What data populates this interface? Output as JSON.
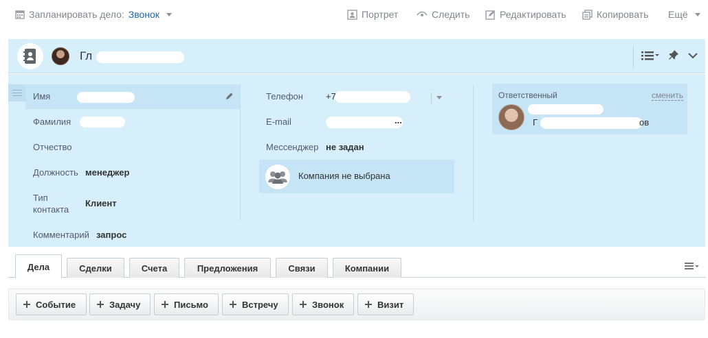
{
  "toolbar": {
    "plan_label": "Запланировать дело:",
    "plan_value": "Звонок",
    "portrait": "Портрет",
    "follow": "Следить",
    "edit": "Редактировать",
    "copy": "Копировать",
    "more": "Ещё"
  },
  "header": {
    "name_visible": "Гл"
  },
  "fields": {
    "first_name_label": "Имя",
    "last_name_label": "Фамилия",
    "middle_name_label": "Отчество",
    "position_label": "Должность",
    "position_value": "менеджер",
    "contact_type_label": "Тип контакта",
    "contact_type_value": "Клиент",
    "comment_label": "Комментарий",
    "comment_value": "запрос",
    "phone_label": "Телефон",
    "phone_value": "+7",
    "email_label": "E-mail",
    "email_value_tail": "...",
    "messenger_label": "Мессенджер",
    "messenger_value": "не задан",
    "company_text": "Компания не выбрана"
  },
  "responsible": {
    "label": "Ответственный",
    "change": "сменить",
    "name_start": "Г",
    "name_end": "ов"
  },
  "tabs": [
    {
      "label": "Дела",
      "active": true
    },
    {
      "label": "Сделки"
    },
    {
      "label": "Счета"
    },
    {
      "label": "Предложения"
    },
    {
      "label": "Связи"
    },
    {
      "label": "Компании"
    }
  ],
  "actions": [
    "Событие",
    "Задачу",
    "Письмо",
    "Встречу",
    "Звонок",
    "Визит"
  ],
  "colors": {
    "panel_bg": "#d6effa",
    "link": "#2067b0",
    "muted_text": "#80868e"
  },
  "icons": [
    "calendar-icon",
    "portrait-icon",
    "eye-icon",
    "edit-icon",
    "copy-icon",
    "contact-card-icon",
    "list-settings-icon",
    "pin-icon",
    "chevron-down-icon",
    "pencil-icon",
    "group-icon",
    "plus-icon"
  ]
}
